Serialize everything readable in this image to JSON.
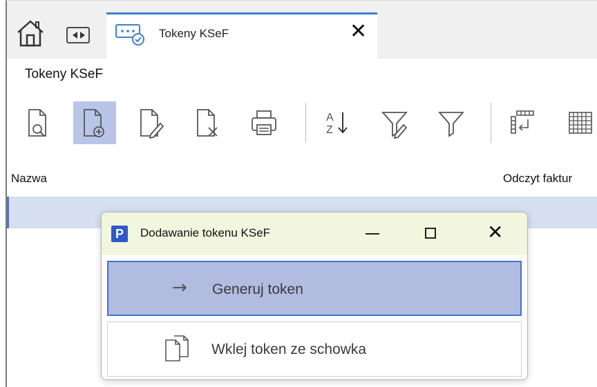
{
  "tabs": {
    "home_icon": "home-icon",
    "nav_icon": "left-right-arrows-icon",
    "active_tab": {
      "label": "Tokeny KSeF",
      "icon": "token-check-icon",
      "close_label": "✕"
    }
  },
  "page": {
    "title": "Tokeny KSeF"
  },
  "toolbar": {
    "items": [
      {
        "icon": "document-search-icon",
        "active": false
      },
      {
        "icon": "document-add-icon",
        "active": true
      },
      {
        "icon": "document-edit-icon",
        "active": false
      },
      {
        "icon": "document-delete-icon",
        "active": false
      },
      {
        "icon": "printer-icon",
        "active": false
      },
      {
        "icon": "sort-az-icon",
        "active": false
      },
      {
        "icon": "filter-edit-icon",
        "active": false
      },
      {
        "icon": "filter-icon",
        "active": false
      },
      {
        "icon": "columns-config-icon",
        "active": false
      },
      {
        "icon": "grid-icon",
        "active": false
      }
    ],
    "sort_letters": {
      "a": "A",
      "z": "Z"
    }
  },
  "table": {
    "columns": [
      "Nazwa",
      "Odczyt faktur"
    ]
  },
  "dialog": {
    "logo_letter": "P",
    "title": "Dodawanie tokenu KSeF",
    "minimize": "minimize-icon",
    "maximize": "maximize-icon",
    "close_label": "✕",
    "options": [
      {
        "arrow": "→",
        "label": "Generuj token",
        "selected": true
      },
      {
        "icon": "paste-icon",
        "label": "Wklej token ze schowka",
        "selected": false
      }
    ]
  },
  "colors": {
    "accent": "#3c7fd0",
    "selected_button": "#b9c5e8",
    "selected_row": "#d5dff0",
    "dialog_titlebar": "#f2f6df",
    "dialog_selected_option": "#b1bce0",
    "logo": "#2f59c8"
  }
}
